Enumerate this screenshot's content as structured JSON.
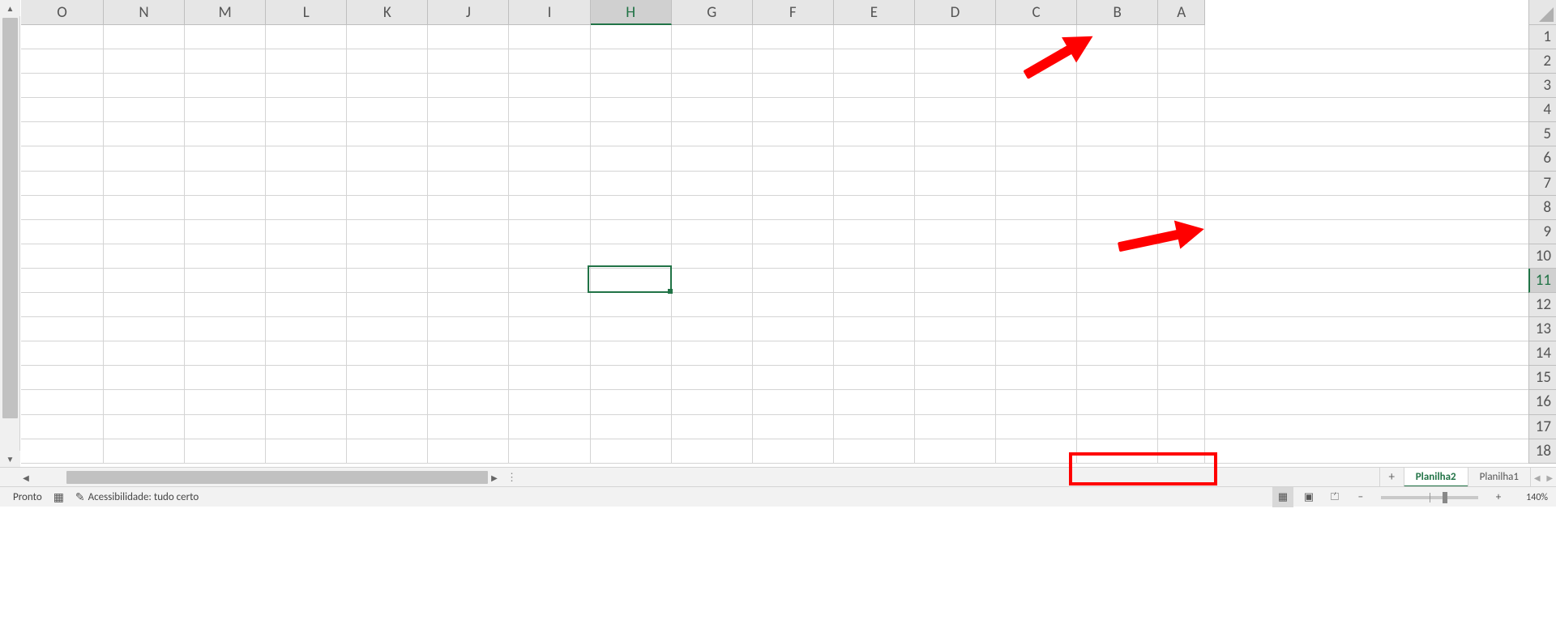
{
  "columns": [
    "O",
    "N",
    "M",
    "L",
    "K",
    "J",
    "I",
    "H",
    "G",
    "F",
    "E",
    "D",
    "C",
    "B",
    "A"
  ],
  "rows": [
    "1",
    "2",
    "3",
    "4",
    "5",
    "6",
    "7",
    "8",
    "9",
    "10",
    "11",
    "12",
    "13",
    "14",
    "15",
    "16",
    "17",
    "18"
  ],
  "active_column": "H",
  "active_row": "11",
  "sheet_tabs": {
    "items": [
      {
        "name": "Planilha2",
        "active": true
      },
      {
        "name": "Planilha1",
        "active": false
      }
    ],
    "add_label": "+"
  },
  "status": {
    "ready": "Pronto",
    "accessibility": "Acessibilidade: tudo certo",
    "zoom": "140%"
  },
  "icons": {
    "record": "▦",
    "accessibility": "✎",
    "view_normal": "▦",
    "view_layout": "▣",
    "view_break": "⏍",
    "minus": "−",
    "plus": "+"
  }
}
